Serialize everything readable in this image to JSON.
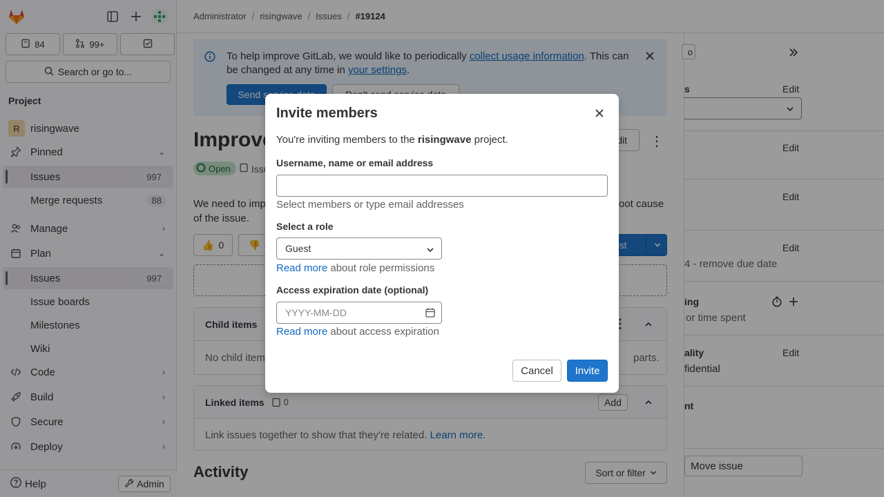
{
  "sidebar": {
    "counts": {
      "issues": "84",
      "merge_requests": "99+"
    },
    "search_label": "Search or go to...",
    "project_heading": "Project",
    "project_avatar_letter": "R",
    "project_name": "risingwave",
    "pinned_label": "Pinned",
    "pinned_items": [
      {
        "label": "Issues",
        "badge": "997"
      },
      {
        "label": "Merge requests",
        "badge": "88"
      }
    ],
    "manage_label": "Manage",
    "plan_label": "Plan",
    "plan_items": [
      {
        "label": "Issues",
        "badge": "997"
      },
      {
        "label": "Issue boards"
      },
      {
        "label": "Milestones"
      },
      {
        "label": "Wiki"
      }
    ],
    "code_label": "Code",
    "build_label": "Build",
    "secure_label": "Secure",
    "deploy_label": "Deploy",
    "help_label": "Help",
    "admin_label": "Admin"
  },
  "breadcrumb": [
    "Administrator",
    "risingwave",
    "Issues",
    "#19124"
  ],
  "banner": {
    "text_before": "To help improve GitLab, we would like to periodically ",
    "link1": "collect usage information",
    "text_middle": ". This can be changed at any time in ",
    "link2": "your settings",
    "text_after": ".",
    "send_button": "Send service data",
    "dont_send_button": "Don't send service data"
  },
  "issue": {
    "title_partial": "Improve",
    "status": "Open",
    "type_partial": "Issu",
    "edit_label": "Edit",
    "desc_left": "We need to imp",
    "desc_right": "oot cause",
    "desc_line2": "of the issue.",
    "thumbs_up": "0",
    "thumbs_down_partial": "(",
    "create_partial": "uest"
  },
  "child_items": {
    "title": "Child items",
    "empty_partial": "No child item",
    "right_partial": "parts."
  },
  "linked_items": {
    "title": "Linked items",
    "count": "0",
    "add_label": "Add",
    "empty_text": "Link issues together to show that they're related.",
    "learn_more": "Learn more."
  },
  "activity": {
    "title": "Activity",
    "sort_label": "Sort or filter"
  },
  "right_panel": {
    "rows": [
      {
        "label_partial": "s",
        "action": "Edit"
      },
      {
        "label_partial": "",
        "action": "Edit"
      },
      {
        "label_partial": "",
        "action": "Edit"
      },
      {
        "label_partial": "",
        "action": "Edit",
        "sub_partial": "4 - ",
        "sub_link": "remove due date"
      },
      {
        "label_partial": "ing",
        "sub_partial": "or time spent"
      },
      {
        "label_partial": "ality",
        "action": "Edit",
        "sub_partial": "fidential"
      },
      {
        "label_partial": "nt"
      }
    ],
    "move_issue": "Move issue",
    "top_button_partial": "o"
  },
  "modal": {
    "title": "Invite members",
    "intro_before": "You're inviting members to the ",
    "intro_project": "risingwave",
    "intro_after": " project.",
    "username_label": "Username, name or email address",
    "username_value": "",
    "username_help": "Select members or type email addresses",
    "role_label": "Select a role",
    "role_value": "Guest",
    "role_help_link": "Read more",
    "role_help_text": " about role permissions",
    "date_label": "Access expiration date (optional)",
    "date_placeholder": "YYYY-MM-DD",
    "date_help_link": "Read more",
    "date_help_text": " about access expiration",
    "cancel_label": "Cancel",
    "invite_label": "Invite"
  },
  "colors": {
    "primary": "#1f75cb",
    "link": "#1068bf",
    "banner_bg": "#e9f3fc",
    "open_badge": "#c3e6cd"
  }
}
